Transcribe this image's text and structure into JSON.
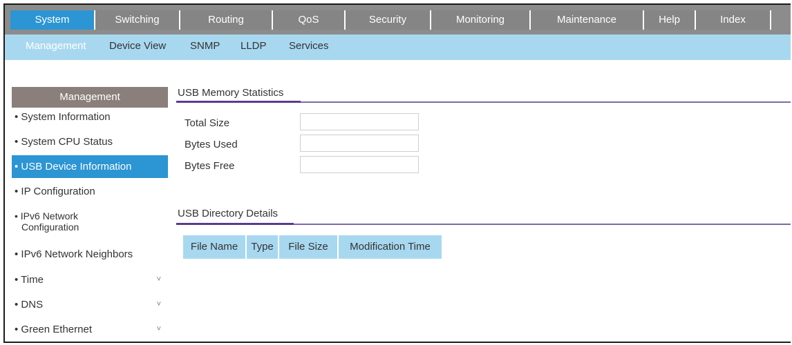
{
  "topnav": {
    "tabs": [
      {
        "label": "System"
      },
      {
        "label": "Switching"
      },
      {
        "label": "Routing"
      },
      {
        "label": "QoS"
      },
      {
        "label": "Security"
      },
      {
        "label": "Monitoring"
      },
      {
        "label": "Maintenance"
      },
      {
        "label": "Help"
      },
      {
        "label": "Index"
      }
    ],
    "active_tab": "System"
  },
  "subnav": {
    "items": [
      {
        "label": "Management"
      },
      {
        "label": "Device View"
      },
      {
        "label": "SNMP"
      },
      {
        "label": "LLDP"
      },
      {
        "label": "Services"
      }
    ],
    "active_item": "Management"
  },
  "sidebar": {
    "header": "Management",
    "items": [
      {
        "label": "• System Information"
      },
      {
        "label": "• System CPU Status"
      },
      {
        "label": "• USB Device Information"
      },
      {
        "label": "• IP Configuration"
      },
      {
        "label": "• IPv6 Network",
        "label2": "Configuration"
      },
      {
        "label": "• IPv6 Network Neighbors"
      },
      {
        "label": "• Time",
        "chevron": "˅"
      },
      {
        "label": "• DNS",
        "chevron": "˅"
      },
      {
        "label": "• Green Ethernet",
        "chevron": "˅"
      }
    ],
    "active_item": "• USB Device Information"
  },
  "usb_memory": {
    "title": "USB Memory Statistics",
    "fields": [
      {
        "label": "Total Size",
        "value": ""
      },
      {
        "label": "Bytes Used",
        "value": ""
      },
      {
        "label": "Bytes Free",
        "value": ""
      }
    ]
  },
  "usb_directory": {
    "title": "USB Directory Details",
    "columns": [
      "File Name",
      "Type",
      "File Size",
      "Modification Time"
    ]
  },
  "colors": {
    "active_tab": "#2c95d3",
    "topnav_bg": "#8c8c8c",
    "subnav_bg": "#a8d8f0",
    "sidebar_header": "#8a7f7a",
    "section_line": "#5b3a8c"
  }
}
